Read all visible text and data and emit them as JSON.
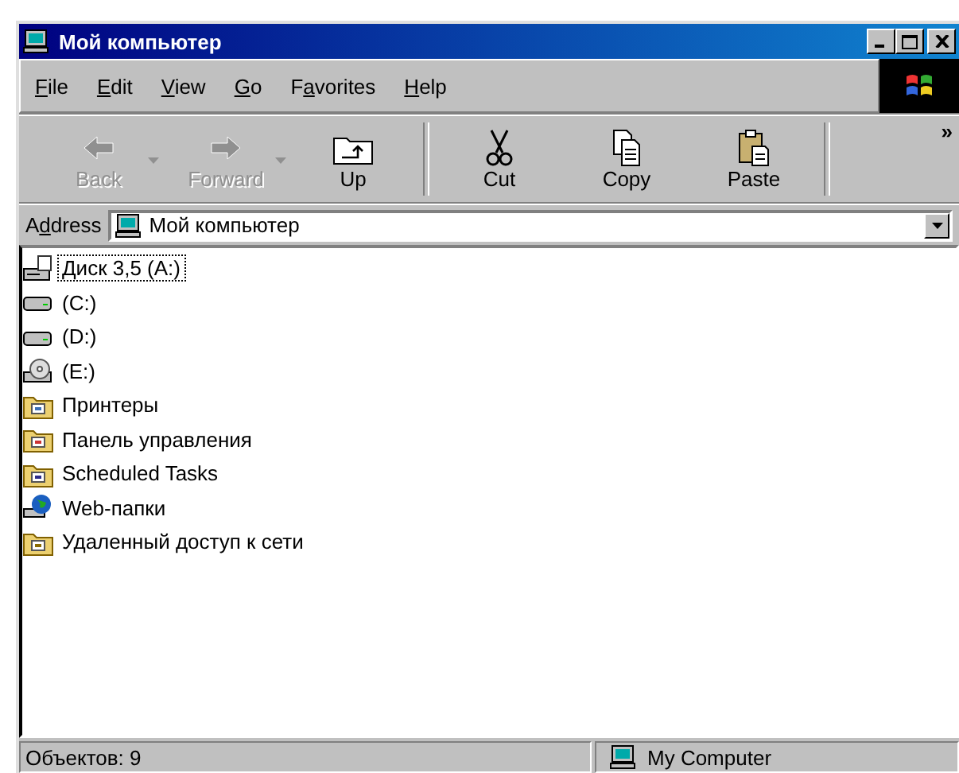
{
  "window": {
    "title": "Мой компьютер"
  },
  "menu": [
    {
      "key": "F",
      "post": "ile"
    },
    {
      "key": "E",
      "post": "dit"
    },
    {
      "key": "V",
      "post": "iew"
    },
    {
      "key": "G",
      "post": "o"
    },
    {
      "pre": "F",
      "key": "a",
      "post": "vorites"
    },
    {
      "key": "H",
      "post": "elp"
    }
  ],
  "toolbar": [
    {
      "kind": "back",
      "label": "Back",
      "disabled": true,
      "dropdown": true
    },
    {
      "kind": "forward",
      "label": "Forward",
      "disabled": true,
      "dropdown": true
    },
    {
      "kind": "up",
      "label": "Up",
      "disabled": false,
      "dropdown": false
    },
    {
      "kind": "cut",
      "label": "Cut",
      "disabled": false,
      "dropdown": false
    },
    {
      "kind": "copy",
      "label": "Copy",
      "disabled": false,
      "dropdown": false
    },
    {
      "kind": "paste",
      "label": "Paste",
      "disabled": false,
      "dropdown": false
    }
  ],
  "toolbar_more": "»",
  "address": {
    "pre": "A",
    "key": "d",
    "post": "dress",
    "value": "Мой компьютер"
  },
  "items": [
    {
      "kind": "floppy",
      "label": "Диск 3,5 (A:)",
      "selected": true
    },
    {
      "kind": "drive",
      "label": "(C:)",
      "selected": false
    },
    {
      "kind": "drive",
      "label": "(D:)",
      "selected": false
    },
    {
      "kind": "cdrom",
      "label": "(E:)",
      "selected": false
    },
    {
      "kind": "printers",
      "label": "Принтеры",
      "selected": false
    },
    {
      "kind": "control",
      "label": "Панель управления",
      "selected": false
    },
    {
      "kind": "tasks",
      "label": "Scheduled Tasks",
      "selected": false
    },
    {
      "kind": "web",
      "label": "Web-папки",
      "selected": false
    },
    {
      "kind": "dialup",
      "label": "Удаленный доступ к сети",
      "selected": false
    }
  ],
  "status_bar": {
    "count": "Объектов: 9",
    "zone": "My Computer"
  }
}
